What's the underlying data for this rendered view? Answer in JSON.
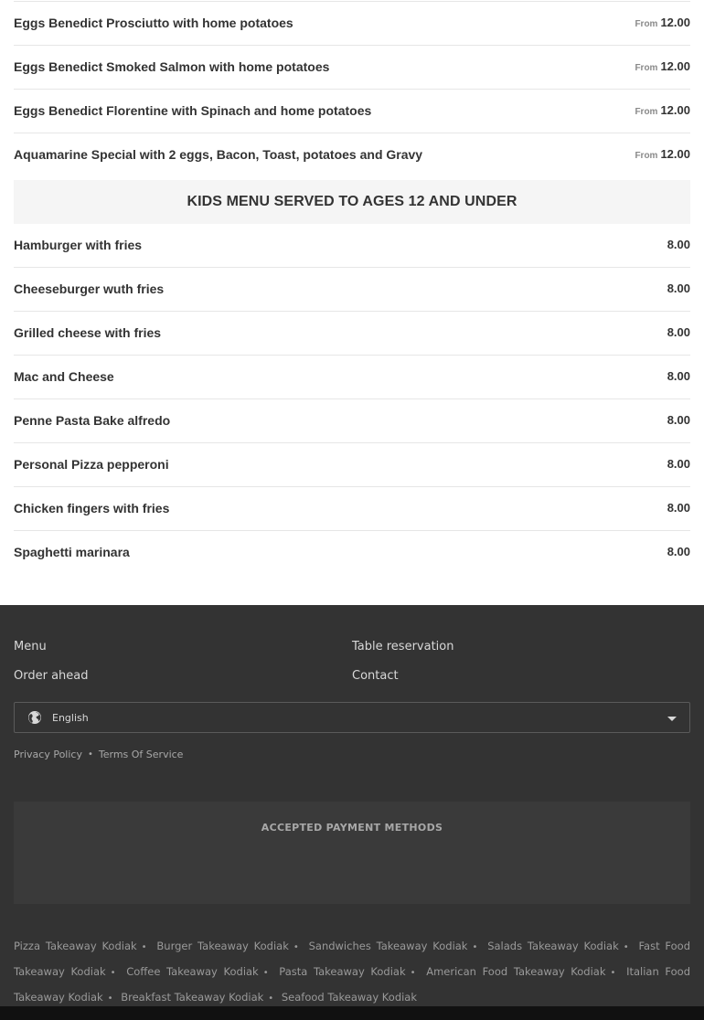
{
  "menu_top": [
    {
      "name": "Eggs Benedict Prosciutto with home potatoes",
      "from": "From",
      "price": "12.00"
    },
    {
      "name": "Eggs Benedict Smoked Salmon with home potatoes",
      "from": "From",
      "price": "12.00"
    },
    {
      "name": "Eggs Benedict Florentine with Spinach and home potatoes",
      "from": "From",
      "price": "12.00"
    },
    {
      "name": "Aquamarine Special with 2 eggs, Bacon, Toast, potatoes and Gravy",
      "from": "From",
      "price": "12.00"
    }
  ],
  "kids_category": "KIDS MENU SERVED TO AGES 12 AND UNDER",
  "kids_items": [
    {
      "name": "Hamburger with fries",
      "price": "8.00"
    },
    {
      "name": "Cheeseburger wuth fries",
      "price": "8.00"
    },
    {
      "name": "Grilled cheese with fries",
      "price": "8.00"
    },
    {
      "name": "Mac and Cheese",
      "price": "8.00"
    },
    {
      "name": "Penne Pasta Bake alfredo",
      "price": "8.00"
    },
    {
      "name": "Personal Pizza pepperoni",
      "price": "8.00"
    },
    {
      "name": "Chicken fingers with fries",
      "price": "8.00"
    },
    {
      "name": "Spaghetti marinara",
      "price": "8.00"
    }
  ],
  "footer": {
    "links": [
      "Menu",
      "Table reservation",
      "Order ahead",
      "Contact"
    ],
    "language": "English",
    "privacy": "Privacy Policy",
    "terms": "Terms Of Service",
    "payment_title": "ACCEPTED PAYMENT METHODS",
    "seo_links": [
      "Pizza Takeaway Kodiak",
      "Burger Takeaway Kodiak",
      "Sandwiches Takeaway Kodiak",
      "Salads Takeaway Kodiak",
      "Fast Food Takeaway Kodiak",
      "Coffee Takeaway Kodiak",
      "Pasta Takeaway Kodiak",
      "American Food Takeaway Kodiak",
      "Italian Food Takeaway Kodiak",
      "Breakfast Takeaway Kodiak",
      "Seafood Takeaway Kodiak"
    ]
  },
  "colors": {
    "footer_bg": "#333333",
    "category_bg": "#f5f5f5"
  }
}
